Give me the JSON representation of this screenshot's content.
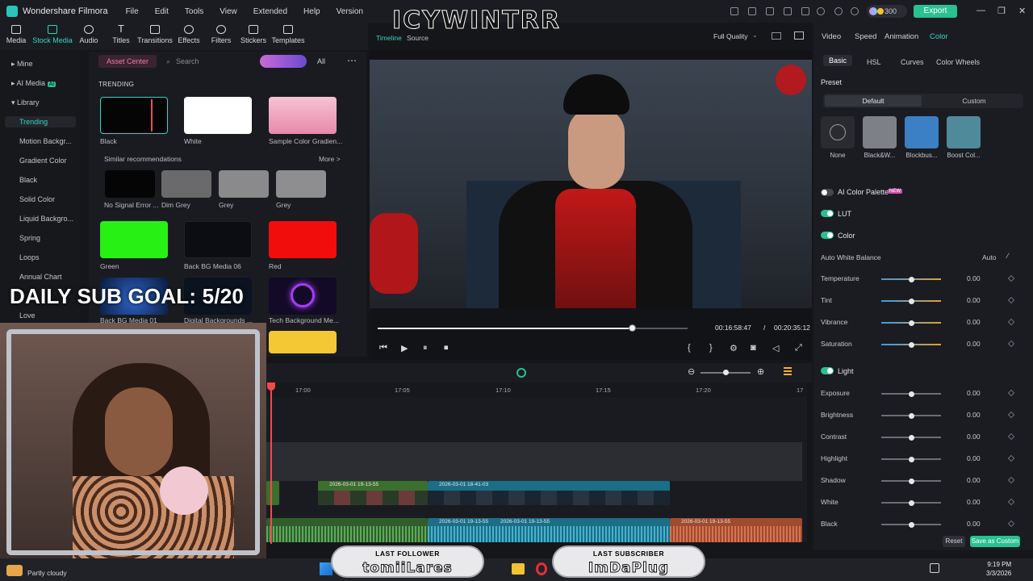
{
  "app": {
    "title": "Wondershare Filmora",
    "menu": [
      "File",
      "Edit",
      "Tools",
      "View",
      "Extended",
      "Help",
      "Version"
    ],
    "credits": "300",
    "export_label": "Export"
  },
  "toolbar": {
    "items": [
      "Media",
      "Stock Media",
      "Audio",
      "Titles",
      "Transitions",
      "Effects",
      "Filters",
      "Stickers",
      "Templates"
    ],
    "active": "Stock Media"
  },
  "sidebar": {
    "items": [
      "Mine",
      "AI Media",
      "Library",
      "Trending",
      "Motion Backgr...",
      "Gradient Color",
      "Black",
      "Solid Color",
      "Liquid Backgro...",
      "Spring",
      "Loops",
      "Annual Chart",
      "Love"
    ],
    "ai_badge": "AI",
    "selected": "Trending"
  },
  "library": {
    "asset_center": "Asset Center",
    "search_placeholder": "Search",
    "filter_all": "All",
    "section": "TRENDING",
    "similar": "Similar recommendations",
    "more": "More >",
    "trending": [
      {
        "label": "Black",
        "color": "#050505"
      },
      {
        "label": "White",
        "color": "#ffffff"
      },
      {
        "label": "Sample Color Gradien...",
        "color": "#f0a6c0"
      }
    ],
    "recs": [
      {
        "label": "No Signal Error ...",
        "color": "#050505"
      },
      {
        "label": "Dim Grey",
        "color": "#6a6a6d"
      },
      {
        "label": "Grey",
        "color": "#8a8a8c"
      },
      {
        "label": "Grey",
        "color": "#8e8e90"
      }
    ],
    "row3": [
      {
        "label": "Green",
        "color": "#27f014"
      },
      {
        "label": "Back BG Media 06",
        "color": "#0c0d12"
      },
      {
        "label": "Red",
        "color": "#f20d0d"
      }
    ],
    "row4": [
      {
        "label": "Back BG Media 01",
        "color": "#091a3a"
      },
      {
        "label": "Digital Backgrounds ...",
        "color": "#0b1220"
      },
      {
        "label": "Tech Background Me...",
        "color": "#120a26"
      }
    ]
  },
  "preview": {
    "tabs": [
      "Timeline",
      "Source"
    ],
    "quality": "Full Quality",
    "current_time": "00:16:58:47",
    "separator": "/",
    "total_time": "00:20:35:12",
    "progress": 0.82
  },
  "right_panel": {
    "tabs": [
      "Video",
      "Speed",
      "Animation",
      "Color"
    ],
    "active_tab": "Color",
    "subtabs": [
      "Basic",
      "HSL",
      "Curves",
      "Color Wheels"
    ],
    "active_subtab": "Basic",
    "preset_label": "Preset",
    "preset_default": "Default",
    "preset_custom": "Custom",
    "presets": [
      {
        "label": "None",
        "color": "#2a2b30"
      },
      {
        "label": "Black&W...",
        "color": "#7e8087"
      },
      {
        "label": "Blockbus...",
        "color": "#3b7fc4"
      },
      {
        "label": "Boost Col...",
        "color": "#4f8a9a"
      }
    ],
    "ai_palette": "AI Color Palette",
    "ai_new": "NEW",
    "lut": "LUT",
    "color": "Color",
    "auto_wb": "Auto White Balance",
    "auto": "Auto",
    "color_sliders": [
      {
        "label": "Temperature",
        "value": "0.00"
      },
      {
        "label": "Tint",
        "value": "0.00"
      },
      {
        "label": "Vibrance",
        "value": "0.00"
      },
      {
        "label": "Saturation",
        "value": "0.00"
      }
    ],
    "light": "Light",
    "light_sliders": [
      {
        "label": "Exposure",
        "value": "0.00"
      },
      {
        "label": "Brightness",
        "value": "0.00"
      },
      {
        "label": "Contrast",
        "value": "0.00"
      },
      {
        "label": "Highlight",
        "value": "0.00"
      },
      {
        "label": "Shadow",
        "value": "0.00"
      },
      {
        "label": "White",
        "value": "0.00"
      },
      {
        "label": "Black",
        "value": "0.00"
      }
    ],
    "reset": "Reset",
    "save": "Save as Custom"
  },
  "timeline": {
    "ruler": [
      "17:00",
      "17:05",
      "17:10",
      "17:15",
      "17:20",
      "17"
    ],
    "clips": [
      {
        "label": "2026-03-01 19-13-55",
        "color": "#3c6e2e"
      },
      {
        "label": "2026-03-01 18-41-03",
        "color": "#1a6e86"
      }
    ],
    "audio": [
      {
        "label": "2026-03-01 19-13-55",
        "color": "#2f5e2c"
      },
      {
        "label": "2026-03-01 19-13-55",
        "color": "#1a6e86"
      },
      {
        "label": "2026-03-01 19-13-55",
        "color": "#a04a2e"
      }
    ]
  },
  "overlay": {
    "sub_goal": "DAILY SUB GOAL: 5/20",
    "watermark": "ICYWINTRR",
    "last_follower_title": "LAST FOLLOWER",
    "last_follower": "tomiiLares",
    "last_sub_title": "LAST SUBSCRIBER",
    "last_sub": "ImDaPlug"
  },
  "taskbar": {
    "weather": "Partly cloudy",
    "time": "9:19 PM",
    "date": "3/3/2026"
  }
}
